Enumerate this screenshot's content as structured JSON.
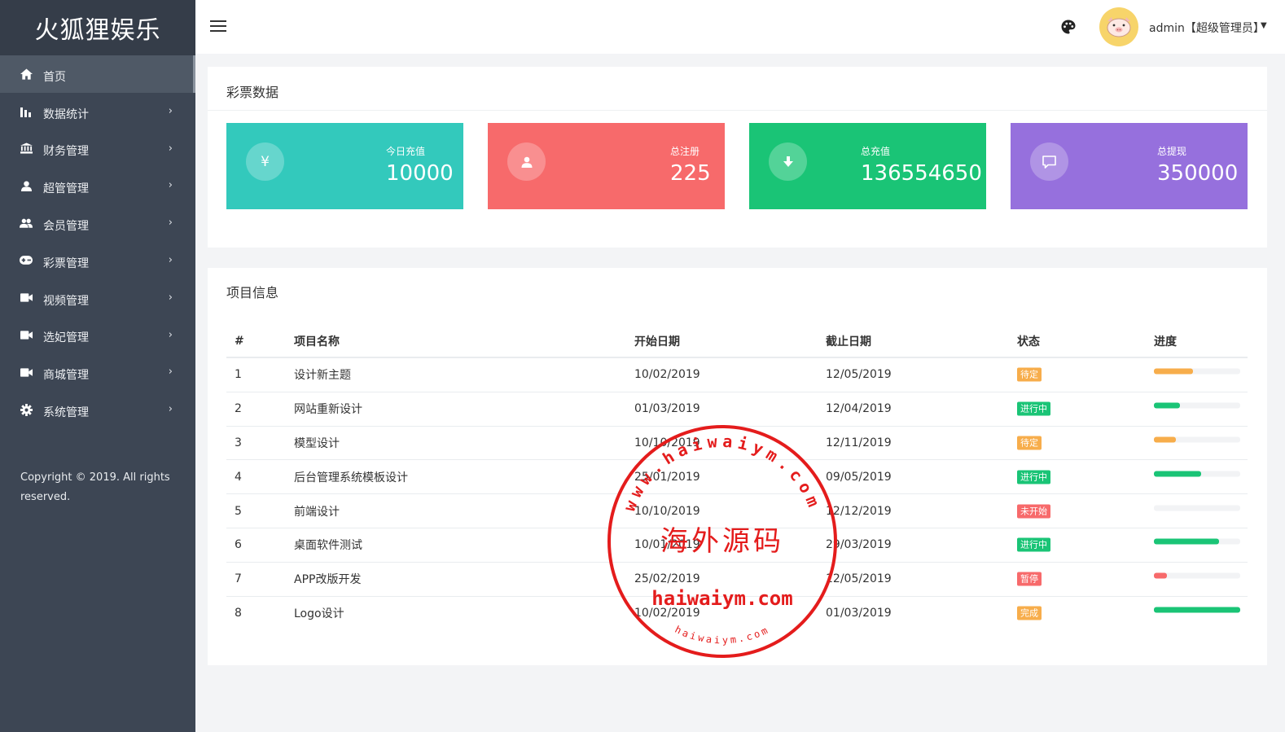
{
  "sidebar": {
    "brand": "火狐狸娱乐",
    "items": [
      {
        "label": "首页",
        "icon": "home-icon",
        "active": true
      },
      {
        "label": "数据统计",
        "icon": "bar-chart-icon"
      },
      {
        "label": "财务管理",
        "icon": "bank-icon"
      },
      {
        "label": "超管管理",
        "icon": "user-icon"
      },
      {
        "label": "会员管理",
        "icon": "users-icon"
      },
      {
        "label": "彩票管理",
        "icon": "gamepad-icon"
      },
      {
        "label": "视频管理",
        "icon": "video-icon"
      },
      {
        "label": "选妃管理",
        "icon": "video-icon"
      },
      {
        "label": "商城管理",
        "icon": "video-icon"
      },
      {
        "label": "系统管理",
        "icon": "gear-icon"
      }
    ],
    "copyright": "Copyright © 2019. All rights reserved."
  },
  "header": {
    "user": "admin【超级管理员】",
    "menu_icon": "hamburger-menu-icon",
    "theme_icon": "palette-icon"
  },
  "lottery": {
    "title": "彩票数据",
    "stats": [
      {
        "label": "今日充值",
        "value": "10000",
        "icon": "yen-icon",
        "color": "#33c9bc"
      },
      {
        "label": "总注册",
        "value": "225",
        "icon": "user-icon",
        "color": "#f76a6b"
      },
      {
        "label": "总充值",
        "value": "136554650",
        "icon": "download-arrow-icon",
        "color": "#1ac476"
      },
      {
        "label": "总提现",
        "value": "350000",
        "icon": "message-icon",
        "color": "#9670dd"
      }
    ]
  },
  "projects": {
    "title": "项目信息",
    "headers": [
      "#",
      "项目名称",
      "开始日期",
      "截止日期",
      "状态",
      "进度"
    ],
    "rows": [
      {
        "no": "1",
        "name": "设计新主题",
        "start": "10/02/2019",
        "end": "12/05/2019",
        "status": "待定",
        "status_color": "#f7ad4b",
        "progress": 45,
        "bar_color": "#f7ad4b"
      },
      {
        "no": "2",
        "name": "网站重新设计",
        "start": "01/03/2019",
        "end": "12/04/2019",
        "status": "进行中",
        "status_color": "#1ac476",
        "progress": 30,
        "bar_color": "#1ac476"
      },
      {
        "no": "3",
        "name": "模型设计",
        "start": "10/10/2019",
        "end": "12/11/2019",
        "status": "待定",
        "status_color": "#f7ad4b",
        "progress": 25,
        "bar_color": "#f7ad4b"
      },
      {
        "no": "4",
        "name": "后台管理系统模板设计",
        "start": "25/01/2019",
        "end": "09/05/2019",
        "status": "进行中",
        "status_color": "#1ac476",
        "progress": 55,
        "bar_color": "#1ac476"
      },
      {
        "no": "5",
        "name": "前端设计",
        "start": "10/10/2019",
        "end": "12/12/2019",
        "status": "未开始",
        "status_color": "#f76a6b",
        "progress": 0,
        "bar_color": "#f76a6b"
      },
      {
        "no": "6",
        "name": "桌面软件测试",
        "start": "10/01/2019",
        "end": "29/03/2019",
        "status": "进行中",
        "status_color": "#1ac476",
        "progress": 75,
        "bar_color": "#1ac476"
      },
      {
        "no": "7",
        "name": "APP改版开发",
        "start": "25/02/2019",
        "end": "12/05/2019",
        "status": "暂停",
        "status_color": "#f76a6b",
        "progress": 15,
        "bar_color": "#f76a6b"
      },
      {
        "no": "8",
        "name": "Logo设计",
        "start": "10/02/2019",
        "end": "01/03/2019",
        "status": "完成",
        "status_color": "#f7ad4b",
        "progress": 100,
        "bar_color": "#1ac476"
      }
    ]
  },
  "watermark": {
    "title": "海外源码",
    "domain": "haiwaiym.com",
    "ring_text": "www.haiwaiym.com",
    "bottom_text": "haiwaiym.com"
  }
}
